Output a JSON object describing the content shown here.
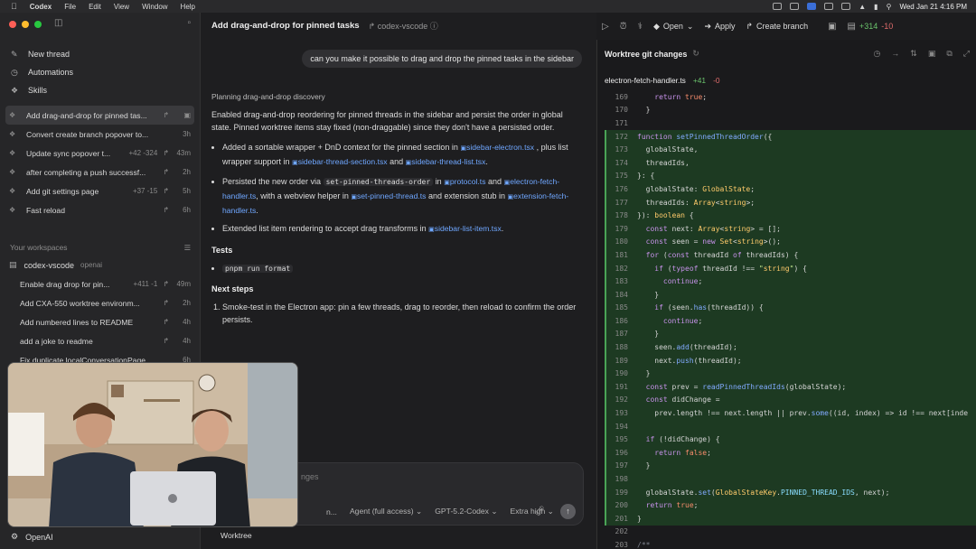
{
  "menubar": {
    "app": "Codex",
    "items": [
      "File",
      "Edit",
      "View",
      "Window",
      "Help"
    ],
    "clock": "Wed Jan 21  4:16 PM"
  },
  "sidebar": {
    "nav": [
      {
        "label": "New thread",
        "icon": "edit-icon"
      },
      {
        "label": "Automations",
        "icon": "clock-icon"
      },
      {
        "label": "Skills",
        "icon": "skills-icon"
      }
    ],
    "pinned": [
      {
        "title": "Add drag-and-drop for pinned tas...",
        "diff": "",
        "time": "",
        "active": true
      },
      {
        "title": "Convert create branch popover to...",
        "diff": "",
        "time": "3h"
      },
      {
        "title": "Update sync popover t...",
        "diff": "+42 -324",
        "time": "43m"
      },
      {
        "title": "after completing a push successf...",
        "diff": "",
        "time": "2h"
      },
      {
        "title": "Add git settings page",
        "diff": "+37 -15",
        "time": "5h"
      },
      {
        "title": "Fast reload",
        "diff": "",
        "time": "6h"
      }
    ],
    "workspaces_label": "Your workspaces",
    "workspace": {
      "name": "codex-vscode",
      "sub": "openai"
    },
    "workspace_threads": [
      {
        "title": "Enable drag drop for pin...",
        "diff": "+411 -1",
        "time": "49m"
      },
      {
        "title": "Add CXA-550 worktree environm...",
        "diff": "",
        "time": "2h"
      },
      {
        "title": "Add numbered lines to README",
        "diff": "",
        "time": "4h"
      },
      {
        "title": "add a joke to readme",
        "diff": "",
        "time": "4h"
      },
      {
        "title": "Fix duplicate localConversationPage...",
        "diff": "",
        "time": "6h"
      }
    ],
    "footer": "OpenAI"
  },
  "main": {
    "title": "Add drag-and-drop for pinned tasks",
    "repo": "codex-vscode",
    "user_message": "can you make it possible to drag and drop the pinned tasks in the sidebar",
    "planning": "Planning drag-and-drop discovery",
    "summary": "Enabled drag-and-drop reordering for pinned threads in the sidebar and persist the order in global state. Pinned worktree items stay fixed (non-draggable) since they don't have a persisted order.",
    "b1_a": "Added a sortable wrapper + DnD context for the pinned section in",
    "b1_chip1": "sidebar-electron.tsx",
    "b1_b": ", plus list wrapper support in",
    "b1_chip2": "sidebar-thread-section.tsx",
    "b1_c": "and",
    "b1_chip3": "sidebar-thread-list.tsx",
    "b1_d": ".",
    "b2_a": "Persisted the new order via",
    "b2_code": "set-pinned-threads-order",
    "b2_b": "in",
    "b2_chip1": "protocol.ts",
    "b2_c": "and",
    "b2_chip2": "electron-fetch-handler.ts",
    "b2_d": ", with a webview helper in",
    "b2_chip3": "set-pinned-thread.ts",
    "b2_e": "and extension stub in",
    "b2_chip4": "extension-fetch-handler.ts",
    "b2_f": ".",
    "b3_a": "Extended list item rendering to accept drag transforms in",
    "b3_chip": "sidebar-list-item.tsx",
    "b3_b": ".",
    "tests_heading": "Tests",
    "test_cmd": "pnpm run format",
    "next_heading": "Next steps",
    "next_1": "Smoke-test in the Electron app: pin a few threads, drag to reorder, then reload to confirm the order persists.",
    "composer_placeholder": "nges",
    "composer_opts": [
      "n...",
      "Agent (full access)",
      "GPT-5.2-Codex",
      "Extra high"
    ],
    "worktree": "Worktree"
  },
  "toolbar": {
    "open": "Open",
    "apply": "Apply",
    "create_branch": "Create branch",
    "additions": "+314",
    "deletions": "-10"
  },
  "diff": {
    "title": "Worktree git changes",
    "file": "electron-fetch-handler.ts",
    "file_add": "+41",
    "file_del": "-0",
    "lines": [
      {
        "n": "169",
        "t": "    return true;",
        "k": "ctx"
      },
      {
        "n": "170",
        "t": "  }",
        "k": "ctx"
      },
      {
        "n": "171",
        "t": "",
        "k": "ctx"
      },
      {
        "n": "172",
        "t": "function setPinnedThreadOrder({",
        "k": "add"
      },
      {
        "n": "173",
        "t": "  globalState,",
        "k": "add"
      },
      {
        "n": "174",
        "t": "  threadIds,",
        "k": "add"
      },
      {
        "n": "175",
        "t": "}: {",
        "k": "add"
      },
      {
        "n": "176",
        "t": "  globalState: GlobalState;",
        "k": "add"
      },
      {
        "n": "177",
        "t": "  threadIds: Array<string>;",
        "k": "add"
      },
      {
        "n": "178",
        "t": "}): boolean {",
        "k": "add"
      },
      {
        "n": "179",
        "t": "  const next: Array<string> = [];",
        "k": "add"
      },
      {
        "n": "180",
        "t": "  const seen = new Set<string>();",
        "k": "add"
      },
      {
        "n": "181",
        "t": "  for (const threadId of threadIds) {",
        "k": "add"
      },
      {
        "n": "182",
        "t": "    if (typeof threadId !== \"string\") {",
        "k": "add"
      },
      {
        "n": "183",
        "t": "      continue;",
        "k": "add"
      },
      {
        "n": "184",
        "t": "    }",
        "k": "add"
      },
      {
        "n": "185",
        "t": "    if (seen.has(threadId)) {",
        "k": "add"
      },
      {
        "n": "186",
        "t": "      continue;",
        "k": "add"
      },
      {
        "n": "187",
        "t": "    }",
        "k": "add"
      },
      {
        "n": "188",
        "t": "    seen.add(threadId);",
        "k": "add"
      },
      {
        "n": "189",
        "t": "    next.push(threadId);",
        "k": "add"
      },
      {
        "n": "190",
        "t": "  }",
        "k": "add"
      },
      {
        "n": "191",
        "t": "  const prev = readPinnedThreadIds(globalState);",
        "k": "add"
      },
      {
        "n": "192",
        "t": "  const didChange =",
        "k": "add"
      },
      {
        "n": "193",
        "t": "    prev.length !== next.length || prev.some((id, index) => id !== next[inde",
        "k": "add"
      },
      {
        "n": "194",
        "t": "",
        "k": "add"
      },
      {
        "n": "195",
        "t": "  if (!didChange) {",
        "k": "add"
      },
      {
        "n": "196",
        "t": "    return false;",
        "k": "add"
      },
      {
        "n": "197",
        "t": "  }",
        "k": "add"
      },
      {
        "n": "198",
        "t": "",
        "k": "add"
      },
      {
        "n": "199",
        "t": "  globalState.set(GlobalStateKey.PINNED_THREAD_IDS, next);",
        "k": "add"
      },
      {
        "n": "200",
        "t": "  return true;",
        "k": "add"
      },
      {
        "n": "201",
        "t": "}",
        "k": "add"
      },
      {
        "n": "202",
        "t": "",
        "k": "ctx"
      },
      {
        "n": "203",
        "t": "/**",
        "k": "ctx"
      }
    ]
  },
  "colors": {
    "accent": "#6fa7ff",
    "add": "#6bc46d",
    "del": "#e06c6c"
  }
}
